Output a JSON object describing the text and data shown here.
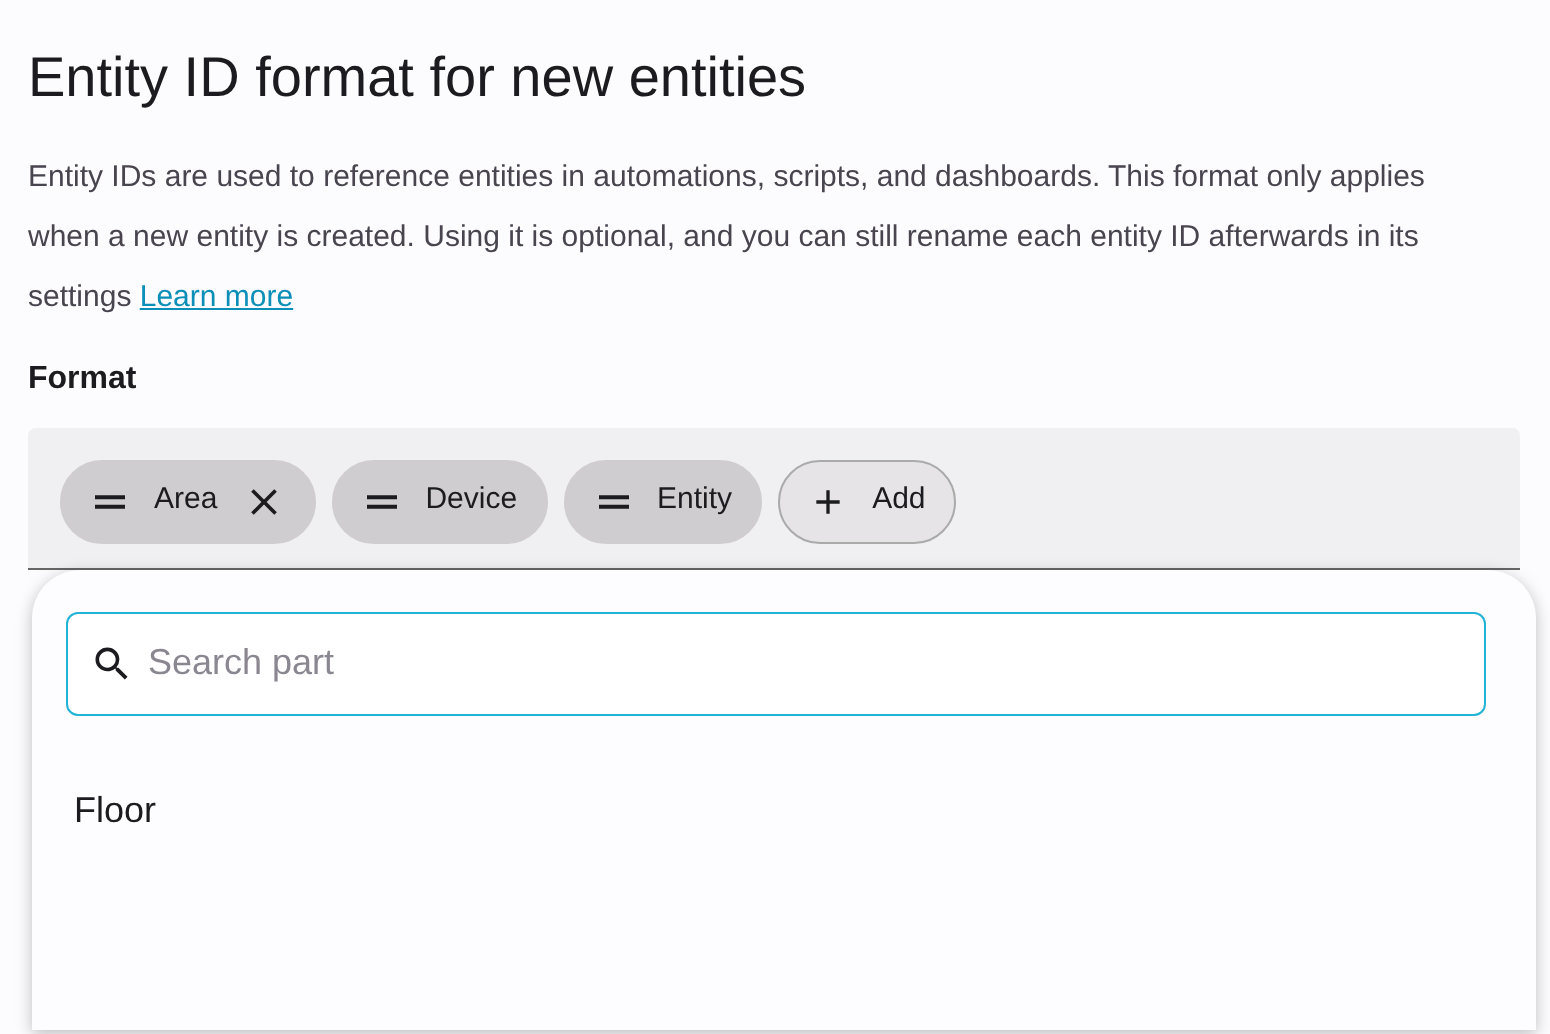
{
  "title": "Entity ID format for new entities",
  "description": "Entity IDs are used to reference entities in automations, scripts, and dashboards. This format only applies when a new entity is created. Using it is optional, and you can still rename each entity ID afterwards in its settings",
  "learn_more_link": "Learn more",
  "format": {
    "label": "Format",
    "chips": [
      {
        "kind": "part",
        "label": "Area",
        "removable": true
      },
      {
        "kind": "part",
        "label": "Device",
        "removable": false
      },
      {
        "kind": "part",
        "label": "Entity",
        "removable": false
      },
      {
        "kind": "add",
        "label": "Add"
      }
    ]
  },
  "dropdown": {
    "search": {
      "placeholder": "Search part"
    },
    "options": [
      {
        "label": "Floor"
      }
    ]
  }
}
